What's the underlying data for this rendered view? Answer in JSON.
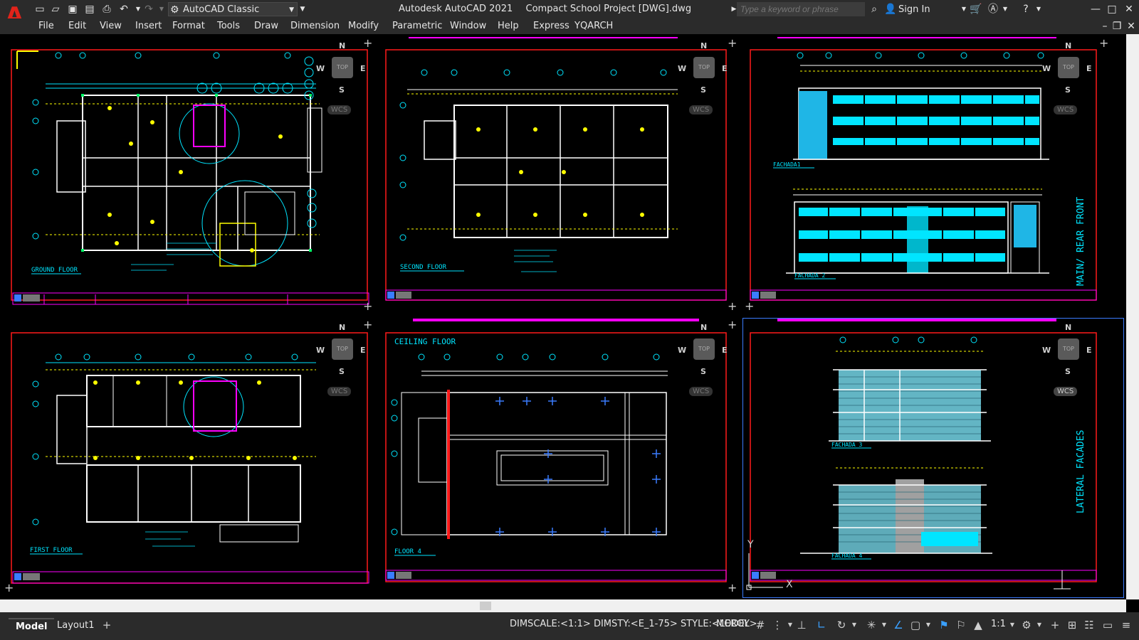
{
  "app": {
    "title": "Autodesk AutoCAD 2021",
    "document": "Compact School Project [DWG].dwg",
    "workspace": "AutoCAD Classic",
    "search_placeholder": "Type a keyword or phrase",
    "sign_in": "Sign In",
    "logo": "A"
  },
  "menu": [
    "File",
    "Edit",
    "View",
    "Insert",
    "Format",
    "Tools",
    "Draw",
    "Dimension",
    "Modify",
    "Parametric",
    "Window",
    "Help",
    "Express",
    "YQARCH"
  ],
  "viewports": [
    {
      "label": "GROUND FLOOR"
    },
    {
      "label": "SECOND FLOOR"
    },
    {
      "label": "FACHADA1",
      "label2": "FACHADA 2",
      "side": "MAIN/ REAR FRONT"
    },
    {
      "label": "FIRST FLOOR"
    },
    {
      "label": "FLOOR 4",
      "top_label": "CEILING FLOOR"
    },
    {
      "label": "FACHADA 3",
      "label2": "FACHADA 4",
      "side": "LATERAL FACADES"
    }
  ],
  "viewcube": {
    "n": "N",
    "s": "S",
    "e": "E",
    "w": "W",
    "top": "TOP",
    "wcs": "WCS"
  },
  "ucs": {
    "y": "Y",
    "x": "X"
  },
  "tabs": {
    "model": "Model",
    "layout": "Layout1"
  },
  "status": {
    "text": "DIMSCALE:<1:1> DIMSTY:<E_1-75> STYLE:<LEROY>",
    "model": "MODEL",
    "scale": "1:1"
  },
  "colors": {
    "accent_red": "#e2231a",
    "cad_cyan": "#00e5ff",
    "cad_yellow": "#ffff00",
    "cad_magenta": "#ff00ff",
    "cad_red": "#ff1a1a"
  }
}
